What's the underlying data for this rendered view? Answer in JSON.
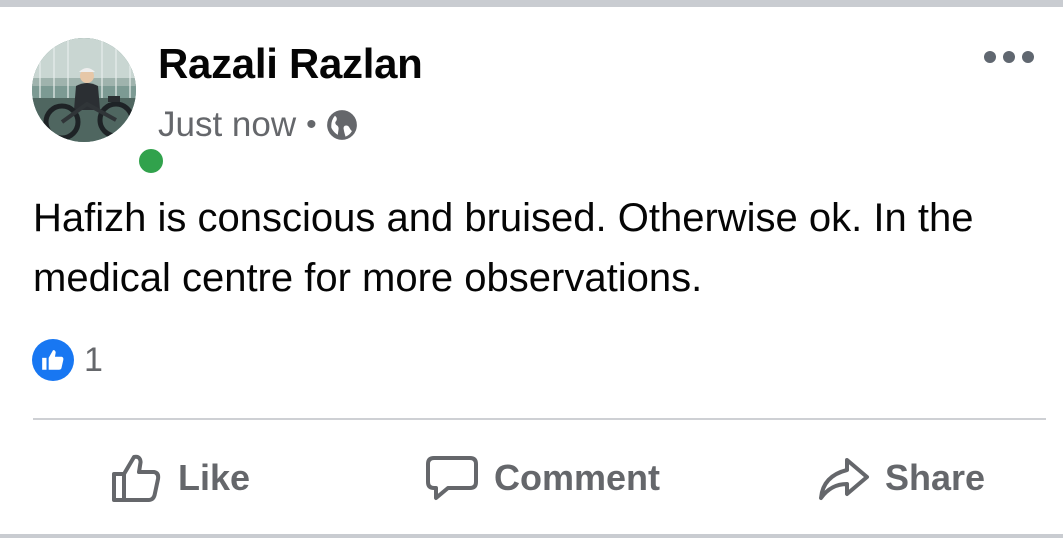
{
  "post": {
    "author": "Razali Razlan",
    "timestamp": "Just now",
    "separator": "•",
    "privacy_icon": "globe-icon",
    "online": true,
    "text": "Hafizh is conscious and bruised. Otherwise ok. In the medical centre for more observations.",
    "reactions": {
      "icon": "like-reaction-icon",
      "count": "1"
    }
  },
  "actions": {
    "like_label": "Like",
    "comment_label": "Comment",
    "share_label": "Share"
  },
  "colors": {
    "accent": "#1877f2",
    "online": "#31a24c",
    "secondary_text": "#65676b",
    "primary_text": "#050505"
  }
}
